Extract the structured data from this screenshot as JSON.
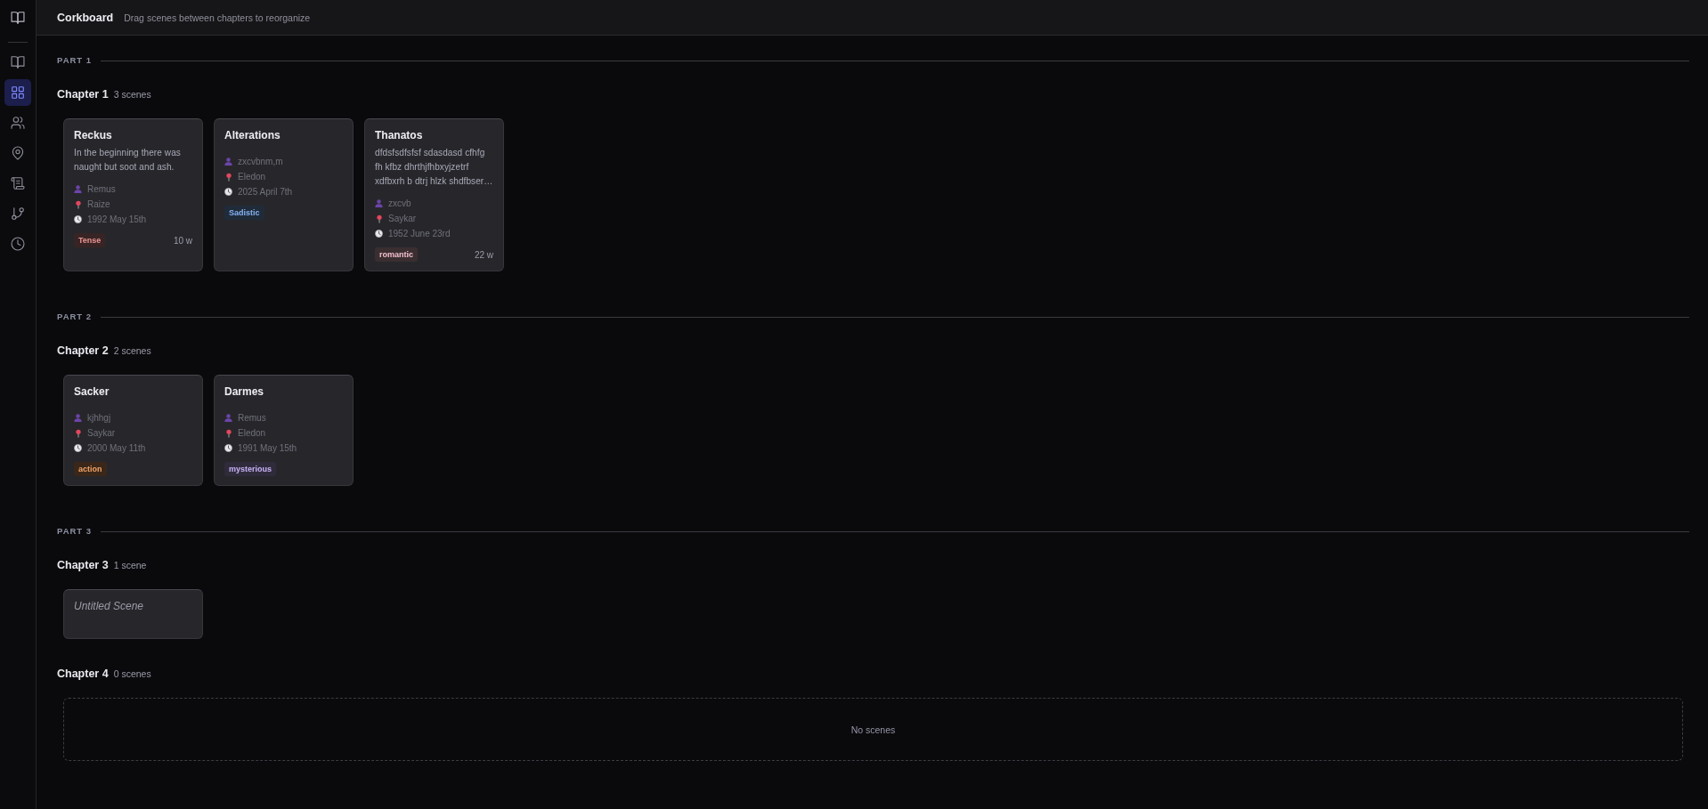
{
  "sidebar": {
    "items": [
      {
        "selected": false
      },
      {
        "selected": true
      },
      {
        "selected": false
      },
      {
        "selected": false
      },
      {
        "selected": false
      },
      {
        "selected": false
      },
      {
        "selected": false
      }
    ]
  },
  "header": {
    "title": "Corkboard",
    "subtitle": "Drag scenes between chapters to reorganize"
  },
  "parts": [
    {
      "label": "PART 1",
      "chapters": [
        {
          "title": "Chapter 1",
          "count": "3 scenes",
          "scenes": [
            {
              "title": "Reckus",
              "untitled": false,
              "synopsis": "In the beginning there was naught but soot and ash.",
              "character": "Remus",
              "location": "Raize",
              "date": "1992 May 15th",
              "tag": {
                "label": "Tense",
                "color": "#ea9494"
              },
              "words": "10 w"
            },
            {
              "title": "Alterations",
              "untitled": false,
              "character": "zxcvbnm,m",
              "location": "Eledon",
              "date": "2025 April 7th",
              "tag": {
                "label": "Sadistic",
                "color": "#84b2f2"
              }
            },
            {
              "title": "Thanatos",
              "untitled": false,
              "synopsis": "dfdsfsdfsfsf sdasdasd cfhfg fh kfbz dhrthjfhbxyjzetrf xdfbxrh b dtrj hlzk shdfbser…",
              "character": "zxcvb",
              "location": "Saykar",
              "date": "1952 June 23rd",
              "tag": {
                "label": "romantic",
                "color": "#f2c0cc"
              },
              "words": "22 w"
            }
          ]
        }
      ]
    },
    {
      "label": "PART 2",
      "chapters": [
        {
          "title": "Chapter 2",
          "count": "2 scenes",
          "scenes": [
            {
              "title": "Sacker",
              "untitled": false,
              "character": "kjhhgj",
              "location": "Saykar",
              "date": "2000 May 11th",
              "tag": {
                "label": "action",
                "color": "#f0a468"
              }
            },
            {
              "title": "Darmes",
              "untitled": false,
              "character": "Remus",
              "location": "Eledon",
              "date": "1991 May 15th",
              "tag": {
                "label": "mysterious",
                "color": "#c8b2f6"
              }
            }
          ]
        }
      ]
    },
    {
      "label": "PART 3",
      "chapters": [
        {
          "title": "Chapter 3",
          "count": "1 scene",
          "scenes": [
            {
              "title": "Untitled Scene",
              "untitled": true
            }
          ]
        },
        {
          "title": "Chapter 4",
          "count": "0 scenes",
          "empty_text": "No scenes"
        }
      ]
    }
  ]
}
